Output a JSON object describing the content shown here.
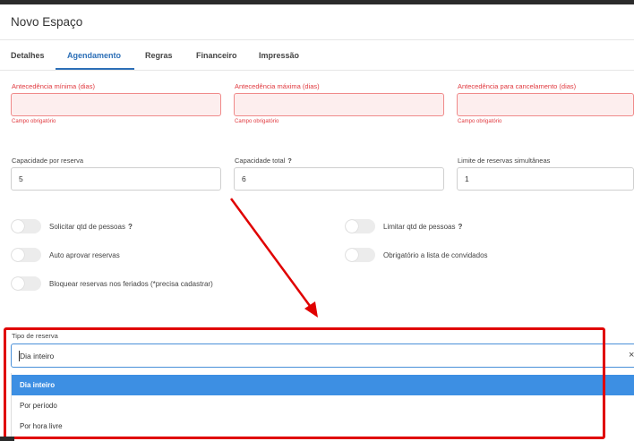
{
  "window": {
    "title": "Novo Espaço"
  },
  "tabs": [
    "Detalhes",
    "Agendamento",
    "Regras",
    "Financeiro",
    "Impressão"
  ],
  "row1": {
    "fields": [
      {
        "label": "Antecedência mínima (dias)",
        "value": "",
        "error": "Campo obrigatório"
      },
      {
        "label": "Antecedência máxima (dias)",
        "value": "",
        "error": "Campo obrigatório"
      },
      {
        "label": "Antecedência para cancelamento (dias)",
        "value": "",
        "error": "Campo obrigatório"
      }
    ]
  },
  "row2": {
    "fields": [
      {
        "label": "Capacidade por reserva",
        "value": "5"
      },
      {
        "label": "Capacidade total",
        "help": "?",
        "value": "6"
      },
      {
        "label": "Limite de reservas simultâneas",
        "value": "1"
      }
    ]
  },
  "toggles": {
    "solicitar": {
      "label": "Solicitar qtd de pessoas",
      "help": "?",
      "on": false
    },
    "limitar": {
      "label": "Limitar qtd de pessoas",
      "help": "?",
      "on": false
    },
    "auto_aprovar": {
      "label": "Auto aprovar reservas",
      "on": false
    },
    "obrigatorio_convidados": {
      "label": "Obrigatório a lista de convidados",
      "on": false
    },
    "bloquear_feriados": {
      "label": "Bloquear reservas nos feriados (*precisa cadastrar)",
      "on": false
    }
  },
  "tipo_reserva": {
    "label": "Tipo de reserva",
    "value": "Dia inteiro",
    "clear_glyph": "×",
    "options": [
      "Dia inteiro",
      "Por período",
      "Por hora livre"
    ]
  },
  "colors": {
    "accent": "#2c6fb7",
    "error": "#e0393f",
    "annotation": "#e00000",
    "option_selected": "#3d8fe3"
  }
}
